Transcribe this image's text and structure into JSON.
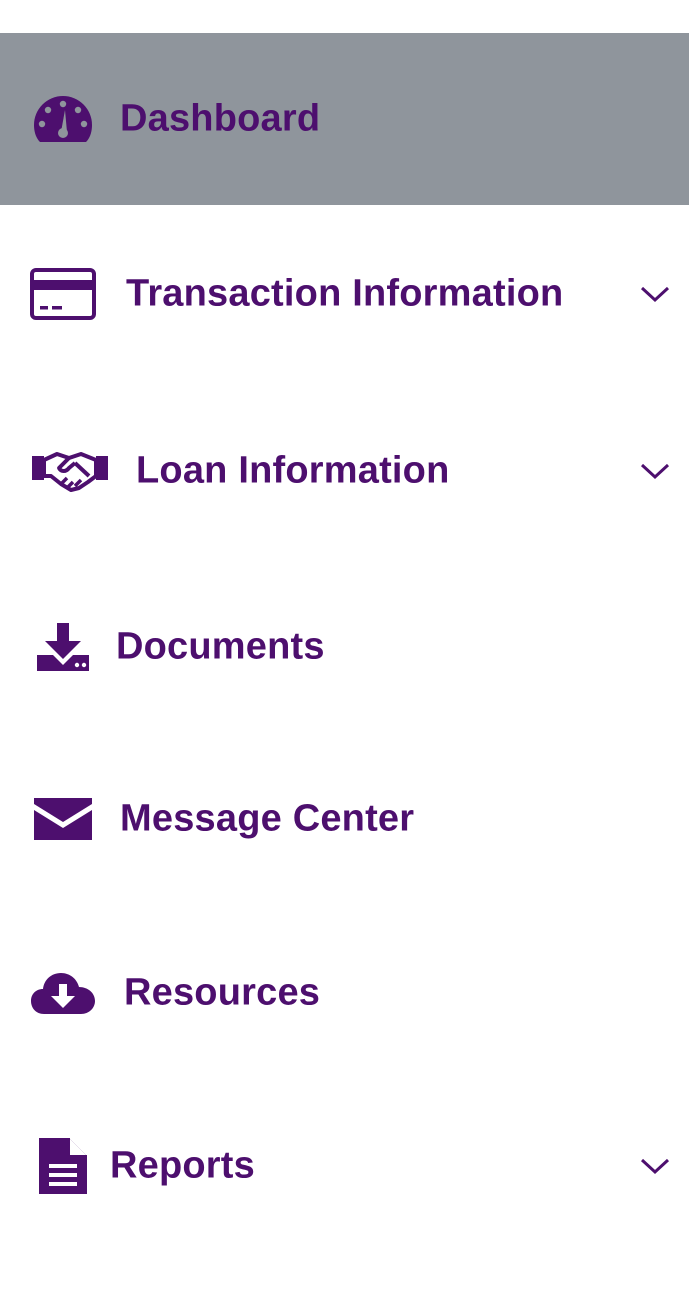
{
  "theme": {
    "text_color": "#4d0f6e",
    "icon_color": "#4d0f6e",
    "active_background": "#8f959c",
    "background": "#ffffff"
  },
  "nav": {
    "items": [
      {
        "label": "Dashboard",
        "icon": "dashboard-gauge-icon",
        "active": true,
        "has_submenu": false
      },
      {
        "label": "Transaction Information",
        "icon": "credit-card-icon",
        "active": false,
        "has_submenu": true
      },
      {
        "label": "Loan Information",
        "icon": "handshake-icon",
        "active": false,
        "has_submenu": true
      },
      {
        "label": "Documents",
        "icon": "download-tray-icon",
        "active": false,
        "has_submenu": false
      },
      {
        "label": "Message Center",
        "icon": "envelope-icon",
        "active": false,
        "has_submenu": false
      },
      {
        "label": "Resources",
        "icon": "cloud-download-icon",
        "active": false,
        "has_submenu": false
      },
      {
        "label": "Reports",
        "icon": "file-text-icon",
        "active": false,
        "has_submenu": true
      }
    ]
  }
}
